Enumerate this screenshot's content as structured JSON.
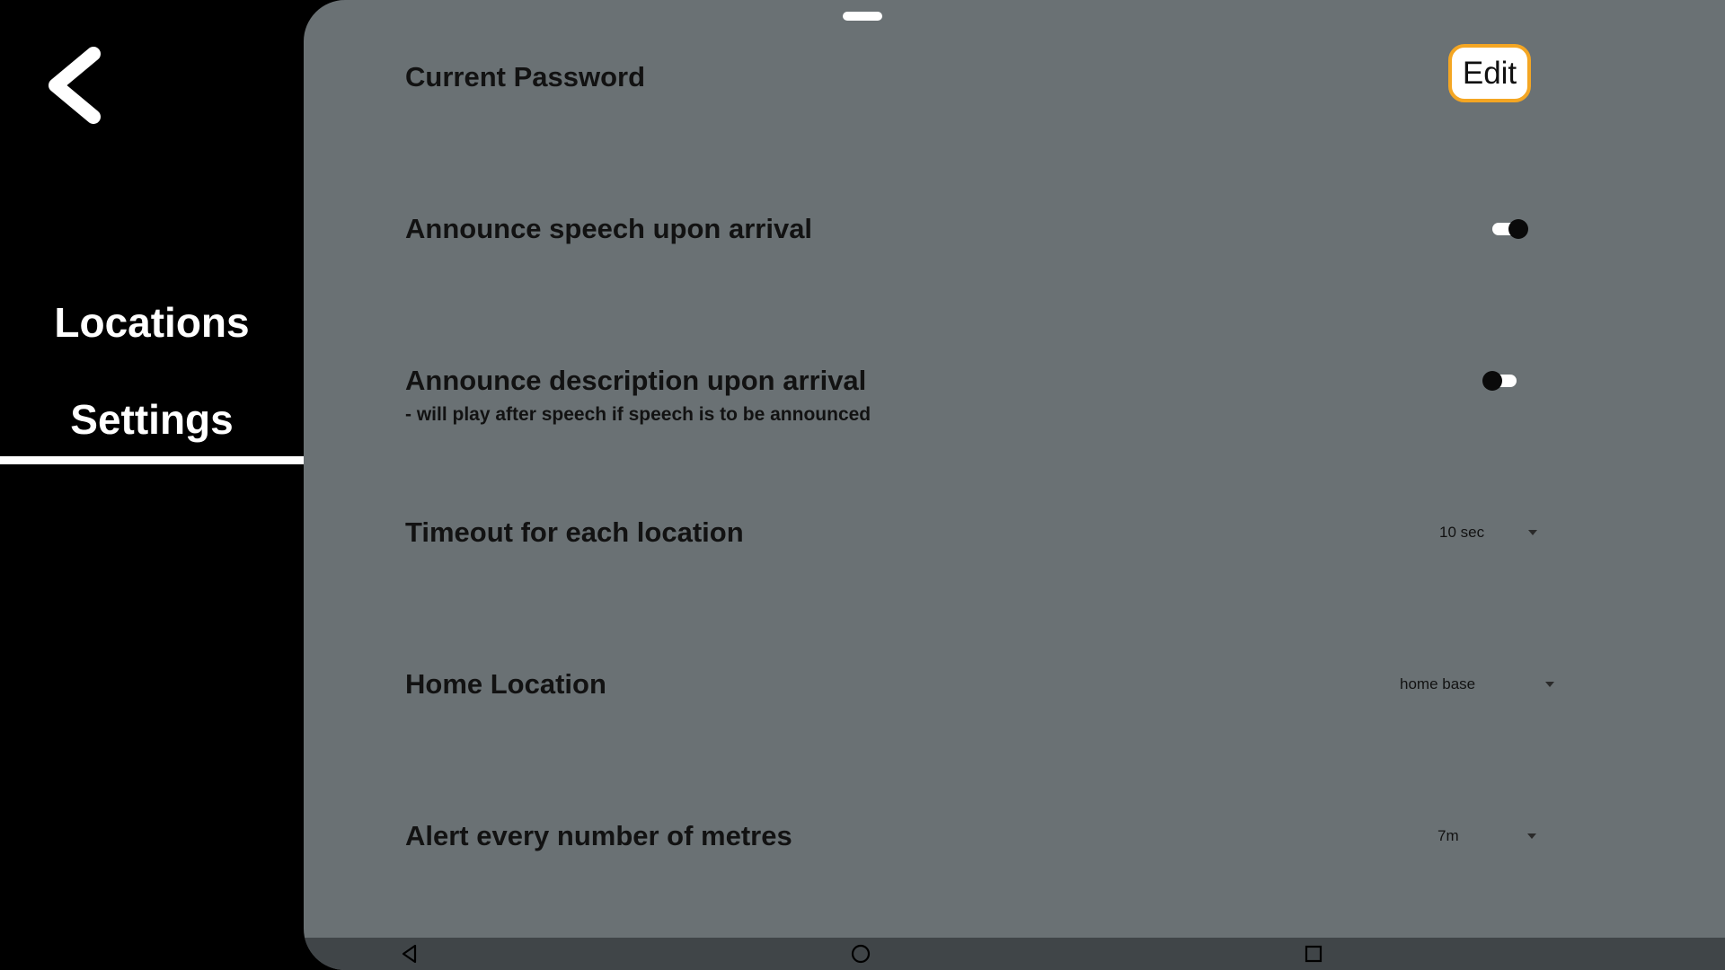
{
  "sidebar": {
    "back_icon": "chevron-left-icon",
    "items": [
      {
        "label": "Locations"
      },
      {
        "label": "Settings",
        "selected": true
      }
    ]
  },
  "settings": {
    "current_password": {
      "label": "Current Password",
      "button": "Edit"
    },
    "announce_speech": {
      "label": "Announce speech upon arrival",
      "enabled": true
    },
    "announce_description": {
      "label": "Announce description upon arrival",
      "subtitle": "- will play after speech if speech is to be announced",
      "enabled": false
    },
    "timeout": {
      "label": "Timeout for each location",
      "value": "10 sec"
    },
    "home_location": {
      "label": "Home Location",
      "value": "home base"
    },
    "alert_metres": {
      "label": "Alert every number of metres",
      "value": "7m"
    }
  },
  "system_nav": {
    "back_icon": "triangle-back-icon",
    "home_icon": "circle-home-icon",
    "recents_icon": "square-recents-icon"
  },
  "colors": {
    "panel_bg": "#6a7174",
    "accent": "#f4a623",
    "sidebar_bg": "#000000"
  }
}
